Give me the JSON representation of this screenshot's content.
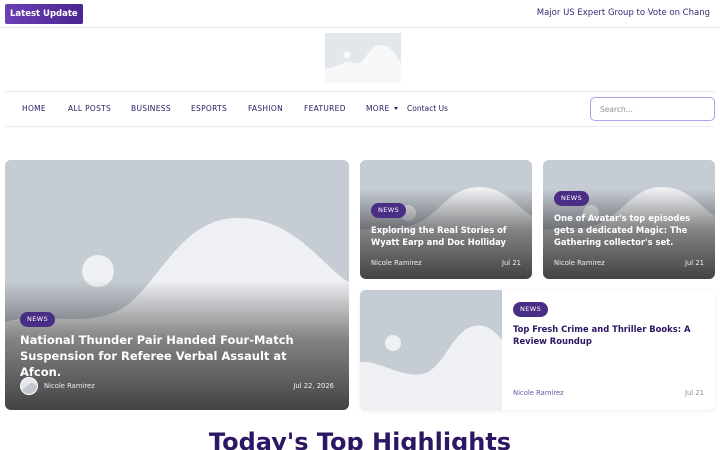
{
  "topbar": {
    "latest_label": "Latest  Update",
    "ticker_text": "Major US Expert Group to Vote on Chang"
  },
  "logo": {
    "icon": "image-placeholder-icon"
  },
  "nav": {
    "items": [
      {
        "label": "HOME"
      },
      {
        "label": "ALL POSTS"
      },
      {
        "label": "BUSINESS"
      },
      {
        "label": "ESPORTS"
      },
      {
        "label": "FASHION"
      },
      {
        "label": "FEATURED"
      },
      {
        "label": "MORE",
        "icon": "caret-down-icon"
      },
      {
        "label": "Contact Us"
      }
    ],
    "search_placeholder": "Search..."
  },
  "featured": {
    "badge": "NEWS",
    "title": "National Thunder Pair Handed Four-Match Suspension for Referee Verbal Assault at Afcon.",
    "author": "Nicole Ramirez",
    "date": "Jul 22, 2026"
  },
  "cards": [
    {
      "badge": "NEWS",
      "title": "Exploring the Real Stories of Wyatt Earp and Doc Holliday",
      "author": "Nicole Ramirez",
      "date": "Jul 21"
    },
    {
      "badge": "NEWS",
      "title": "One of Avatar's top episodes gets a dedicated Magic: The Gathering collector's set.",
      "author": "Nicole Ramirez",
      "date": "Jul 21"
    },
    {
      "badge": "NEWS",
      "title": "Top Fresh Crime and Thriller Books: A Review Roundup",
      "author": "Nicole Ramirez",
      "date": "Jul 21"
    }
  ],
  "section": {
    "title": "Today's Top Highlights"
  },
  "colors": {
    "accent": "#4a2e86",
    "heading": "#2d1663",
    "search_border": "#b59ee6"
  }
}
